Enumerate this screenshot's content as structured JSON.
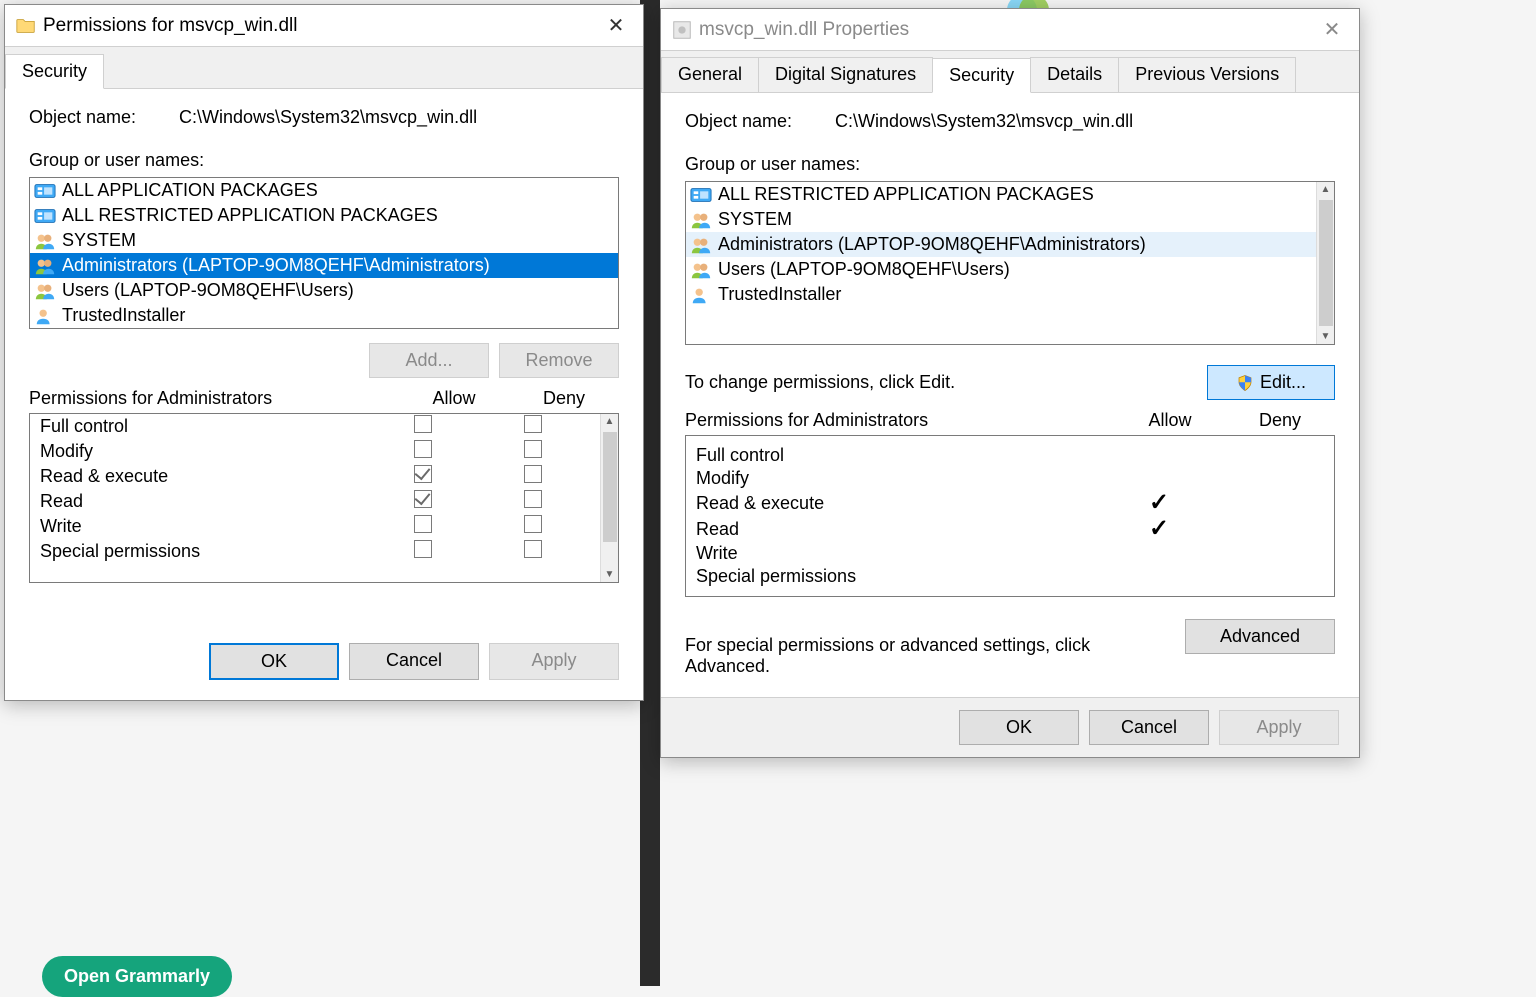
{
  "permDialog": {
    "title": "Permissions for msvcp_win.dll",
    "tabs": {
      "security": "Security"
    },
    "objectNameLabel": "Object name:",
    "objectName": "C:\\Windows\\System32\\msvcp_win.dll",
    "groupLabel": "Group or user names:",
    "principals": [
      {
        "name": "ALL APPLICATION PACKAGES",
        "type": "pkg",
        "selected": false
      },
      {
        "name": "ALL RESTRICTED APPLICATION PACKAGES",
        "type": "pkg",
        "selected": false
      },
      {
        "name": "SYSTEM",
        "type": "group",
        "selected": false
      },
      {
        "name": "Administrators (LAPTOP-9OM8QEHF\\Administrators)",
        "type": "group",
        "selected": true
      },
      {
        "name": "Users (LAPTOP-9OM8QEHF\\Users)",
        "type": "group",
        "selected": false
      },
      {
        "name": "TrustedInstaller",
        "type": "user",
        "selected": false
      }
    ],
    "addBtn": "Add...",
    "removeBtn": "Remove",
    "permHeader": "Permissions for Administrators",
    "colAllow": "Allow",
    "colDeny": "Deny",
    "permRows": [
      {
        "name": "Full control",
        "allow": false,
        "deny": false
      },
      {
        "name": "Modify",
        "allow": false,
        "deny": false
      },
      {
        "name": "Read & execute",
        "allow": true,
        "deny": false
      },
      {
        "name": "Read",
        "allow": true,
        "deny": false
      },
      {
        "name": "Write",
        "allow": false,
        "deny": false
      },
      {
        "name": "Special permissions",
        "allow": false,
        "deny": false
      }
    ],
    "ok": "OK",
    "cancel": "Cancel",
    "apply": "Apply"
  },
  "propsDialog": {
    "title": "msvcp_win.dll Properties",
    "tabs": {
      "general": "General",
      "digsig": "Digital Signatures",
      "security": "Security",
      "details": "Details",
      "prev": "Previous Versions"
    },
    "activeTab": "security",
    "objectNameLabel": "Object name:",
    "objectName": "C:\\Windows\\System32\\msvcp_win.dll",
    "groupLabel": "Group or user names:",
    "principals": [
      {
        "name": "ALL RESTRICTED APPLICATION PACKAGES",
        "type": "pkg",
        "hover": false
      },
      {
        "name": "SYSTEM",
        "type": "group",
        "hover": false
      },
      {
        "name": "Administrators (LAPTOP-9OM8QEHF\\Administrators)",
        "type": "group",
        "hover": true
      },
      {
        "name": "Users (LAPTOP-9OM8QEHF\\Users)",
        "type": "group",
        "hover": false
      },
      {
        "name": "TrustedInstaller",
        "type": "user",
        "hover": false
      }
    ],
    "editHint": "To change permissions, click Edit.",
    "editBtn": "Edit...",
    "permHeader": "Permissions for Administrators",
    "colAllow": "Allow",
    "colDeny": "Deny",
    "permRows": [
      {
        "name": "Full control",
        "allow": false,
        "deny": false
      },
      {
        "name": "Modify",
        "allow": false,
        "deny": false
      },
      {
        "name": "Read & execute",
        "allow": true,
        "deny": false
      },
      {
        "name": "Read",
        "allow": true,
        "deny": false
      },
      {
        "name": "Write",
        "allow": false,
        "deny": false
      },
      {
        "name": "Special permissions",
        "allow": false,
        "deny": false
      }
    ],
    "advHint": "For special permissions or advanced settings, click Advanced.",
    "advancedBtn": "Advanced",
    "ok": "OK",
    "cancel": "Cancel",
    "apply": "Apply"
  },
  "misc": {
    "grammarlyPill": "Open Grammarly"
  }
}
